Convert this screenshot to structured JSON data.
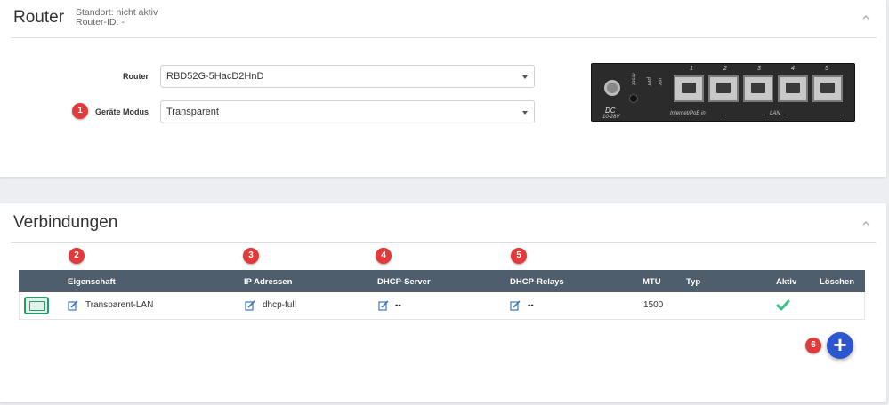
{
  "router_card": {
    "title": "Router",
    "location": "Standort: nicht aktiv",
    "router_id": "Router-ID: -",
    "router_label": "Router",
    "router_value": "RBD52G-5HacD2HnD",
    "mode_label": "Geräte Modus",
    "mode_value": "Transparent",
    "device_image": {
      "port_numbers": [
        "1",
        "2",
        "3",
        "4",
        "5"
      ],
      "labels": [
        "DC",
        "10-28V",
        "reset",
        "pwr",
        "usr",
        "Internet/PoE in",
        "LAN"
      ]
    }
  },
  "connections_card": {
    "title": "Verbindungen",
    "headers": [
      "Eigenschaft",
      "IP Adressen",
      "DHCP-Server",
      "DHCP-Relays",
      "MTU",
      "Typ",
      "Aktiv",
      "Löschen"
    ],
    "rows": [
      {
        "eigenschaft": "Transparent-LAN",
        "ip": "dhcp-full",
        "dhcp_server": "--",
        "dhcp_relays": "--",
        "mtu": "1500",
        "typ": "",
        "aktiv": true
      }
    ],
    "add_button": "+"
  },
  "badges": [
    "1",
    "2",
    "3",
    "4",
    "5",
    "6"
  ],
  "colors": {
    "badge": "#e03a3a",
    "table_header": "#4f5e6d",
    "add_button": "#2c56cf",
    "active_check": "#3cc08a",
    "lan_icon": "#2e9a6b"
  },
  "icons": [
    "chevron-up-icon",
    "edit-icon",
    "lan-port-icon",
    "check-icon",
    "plus-icon",
    "dropdown-caret-icon"
  ]
}
